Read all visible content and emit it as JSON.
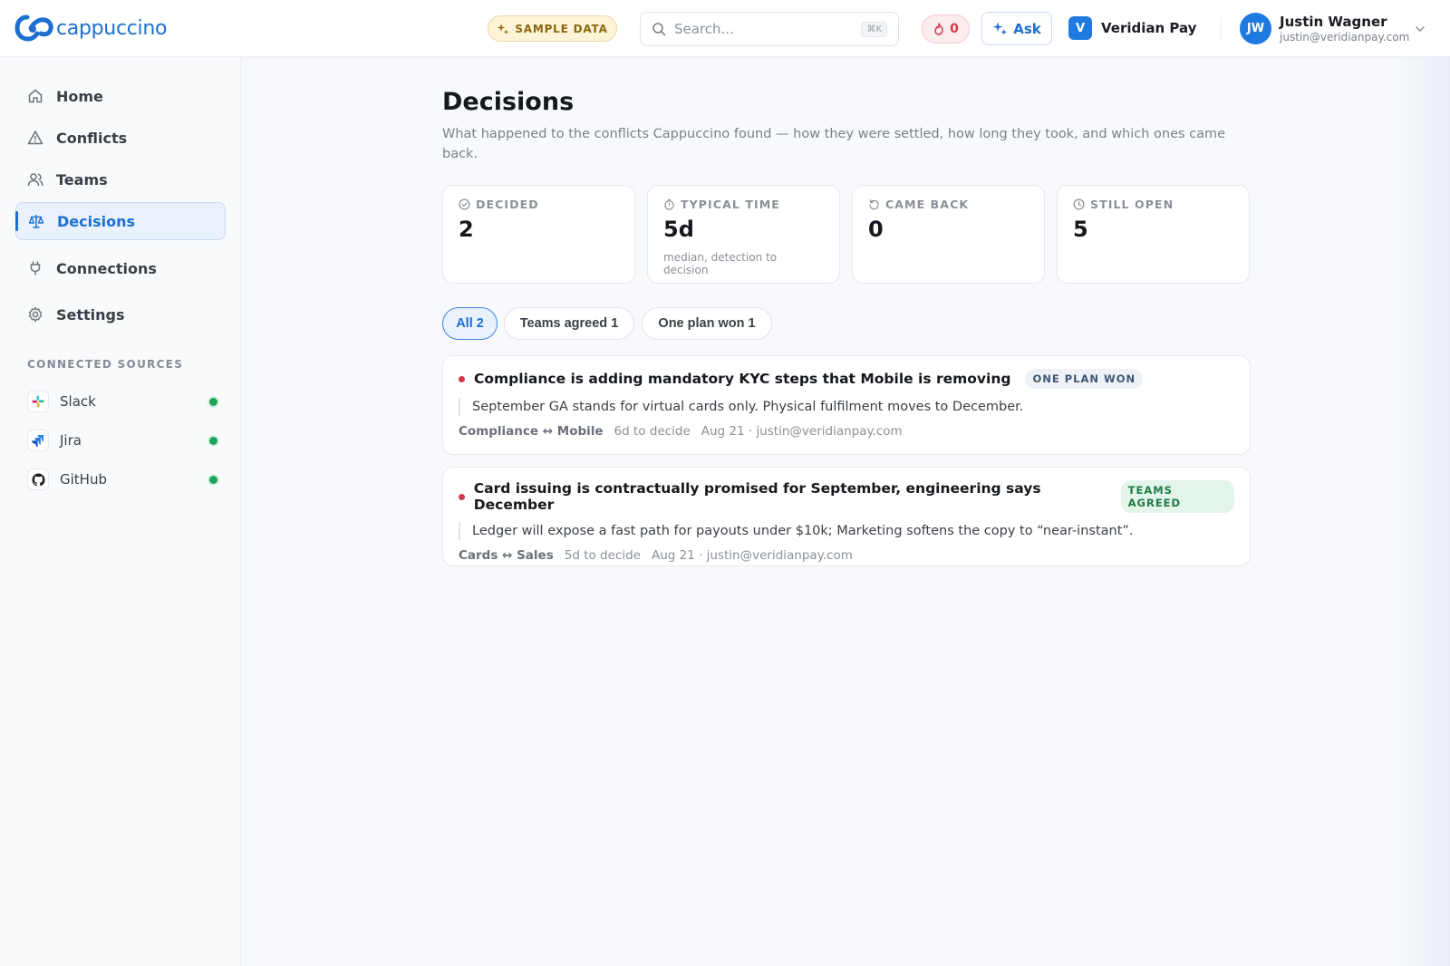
{
  "brand": {
    "name": "cappuccino"
  },
  "topbar": {
    "sample_label": "SAMPLE DATA",
    "search_placeholder": "Search...",
    "search_shortcut": "⌘K",
    "alerts_count": "0",
    "ask_label": "Ask",
    "org_initial": "V",
    "org_name": "Veridian Pay",
    "user_initials": "JW",
    "user_name": "Justin Wagner",
    "user_email": "justin@veridianpay.com"
  },
  "sidebar": {
    "nav": [
      {
        "label": "Home",
        "icon": "home-icon"
      },
      {
        "label": "Conflicts",
        "icon": "warning-icon"
      },
      {
        "label": "Teams",
        "icon": "users-icon"
      },
      {
        "label": "Decisions",
        "icon": "scale-icon",
        "active": true
      },
      {
        "label": "Connections",
        "icon": "plug-icon"
      },
      {
        "label": "Settings",
        "icon": "gear-icon"
      }
    ],
    "sources_label": "CONNECTED SOURCES",
    "sources": [
      {
        "label": "Slack",
        "icon": "slack-icon",
        "status": "connected"
      },
      {
        "label": "Jira",
        "icon": "jira-icon",
        "status": "connected"
      },
      {
        "label": "GitHub",
        "icon": "github-icon",
        "status": "connected"
      }
    ]
  },
  "page": {
    "title": "Decisions",
    "description": "What happened to the conflicts Cappuccino found — how they were settled, how long they took, and which ones came back."
  },
  "stats": [
    {
      "label": "DECIDED",
      "value": "2",
      "sub": "",
      "icon": "check-circle-icon"
    },
    {
      "label": "TYPICAL TIME",
      "value": "5d",
      "sub": "median, detection to decision",
      "icon": "stopwatch-icon"
    },
    {
      "label": "CAME BACK",
      "value": "0",
      "sub": "",
      "icon": "rotate-icon"
    },
    {
      "label": "STILL OPEN",
      "value": "5",
      "sub": "",
      "icon": "clock-icon"
    }
  ],
  "filters": [
    {
      "label": "All 2",
      "active": true
    },
    {
      "label": "Teams agreed 1",
      "active": false
    },
    {
      "label": "One plan won 1",
      "active": false
    }
  ],
  "decisions": [
    {
      "title": "Compliance is adding mandatory KYC steps that Mobile is removing",
      "badge": "ONE PLAN WON",
      "summary": "September GA stands for virtual cards only. Physical fulfilment moves to December.",
      "teams": "Compliance ↔ Mobile",
      "duration": "6d to decide",
      "meta": "Aug 21 · justin@veridianpay.com"
    },
    {
      "title": "Card issuing is contractually promised for September, engineering says December",
      "badge": "TEAMS AGREED",
      "summary": "Ledger will expose a fast path for payouts under $10k; Marketing softens the copy to “near-instant”.",
      "teams": "Cards ↔ Sales",
      "duration": "5d to decide",
      "meta": "Aug 21 · justin@veridianpay.com"
    }
  ],
  "colors": {
    "accent": "#1c6fd1",
    "danger": "#d23a4a",
    "success": "#1ea35a"
  }
}
